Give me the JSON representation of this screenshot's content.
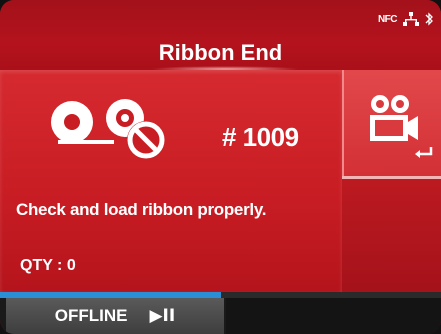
{
  "header": {
    "title": "Ribbon End",
    "status_icons": [
      "nfc-icon",
      "network-icon",
      "bluetooth-icon"
    ],
    "nfc_label": "NFC"
  },
  "main": {
    "error_code": "# 1009",
    "message": "Check and load ribbon properly.",
    "qty_label": "QTY : 0",
    "icon": "ribbon-error-icon"
  },
  "side": {
    "button_icon": "video-camera-icon",
    "enter_icon": "enter-arrow-icon"
  },
  "footer": {
    "status_label": "OFFLINE",
    "play_pause_glyph": "▶II",
    "progress_fraction": 0.5
  },
  "colors": {
    "primary_red": "#c91d24",
    "accent_blue": "#2b8fd6",
    "footer_dark": "#1a1a1a"
  }
}
